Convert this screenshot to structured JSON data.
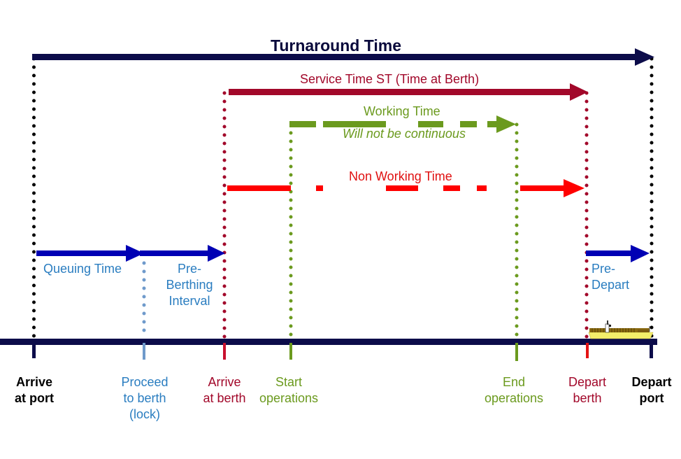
{
  "title": "Turnaround Time",
  "colors": {
    "navy": "#0c0c4a",
    "black": "#000000",
    "blue_arrow": "#0000b4",
    "light_blue": "#6f9acb",
    "text_blue": "#2a7dc0",
    "crimson": "#a2082a",
    "green": "#6b9a1e",
    "red": "#ff0000",
    "ship_hull": "#f4ee6a",
    "ship_cargo": "#8a6a10"
  },
  "spans": {
    "turnaround": {
      "label": "Turnaround Time",
      "from": "arrive_port",
      "to": "depart_port"
    },
    "service": {
      "label": "Service Time ST (Time at Berth)",
      "from": "arrive_berth",
      "to": "depart_berth"
    },
    "working": {
      "label": "Working Time",
      "note": "Will not be continuous",
      "from": "start_ops",
      "to": "end_ops",
      "style": "dashed"
    },
    "non_working": {
      "label": "Non Working Time",
      "from": "arrive_berth",
      "to": "depart_berth",
      "style": "dash-dot"
    },
    "queuing": {
      "label": "Queuing Time",
      "from": "arrive_port",
      "to": "proceed_berth"
    },
    "pre_berthing": {
      "label_line1": "Pre-",
      "label_line2": "Berthing",
      "label_line3": "Interval",
      "from": "proceed_berth",
      "to": "arrive_berth"
    },
    "pre_depart": {
      "label_line1": "Pre-",
      "label_line2": "Depart",
      "from": "depart_berth",
      "to": "depart_port"
    }
  },
  "events": [
    {
      "id": "arrive_port",
      "line1": "Arrive",
      "line2": "at port",
      "line3": "",
      "color": "#000000",
      "bold": true
    },
    {
      "id": "proceed_berth",
      "line1": "Proceed",
      "line2": "to berth",
      "line3": "(lock)",
      "color": "#2a7dc0",
      "bold": false
    },
    {
      "id": "arrive_berth",
      "line1": "Arrive",
      "line2": "at berth",
      "line3": "",
      "color": "#a2082a",
      "bold": false
    },
    {
      "id": "start_ops",
      "line1": "Start",
      "line2": "operations",
      "line3": "",
      "color": "#6b9a1e",
      "bold": false
    },
    {
      "id": "end_ops",
      "line1": "End",
      "line2": "operations",
      "line3": "",
      "color": "#6b9a1e",
      "bold": false
    },
    {
      "id": "depart_berth",
      "line1": "Depart",
      "line2": "berth",
      "line3": "",
      "color": "#a2082a",
      "bold": false
    },
    {
      "id": "depart_port",
      "line1": "Depart",
      "line2": "port",
      "line3": "",
      "color": "#000000",
      "bold": true
    }
  ],
  "ship_icon": "container-ship-icon"
}
